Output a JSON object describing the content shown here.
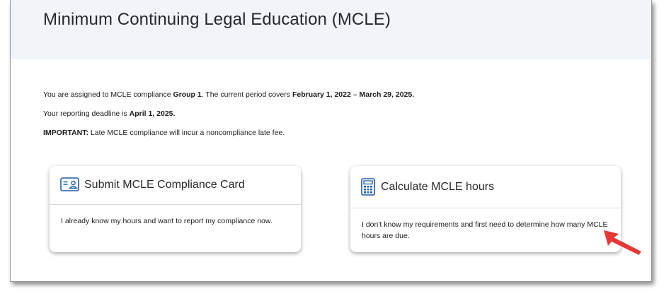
{
  "page": {
    "title": "Minimum Continuing Legal Education (MCLE)"
  },
  "info": {
    "line1_pre": "You are assigned to MCLE compliance ",
    "group": "Group 1",
    "line1_mid": ". The current period covers ",
    "period": "February 1, 2022 – March 29, 2025.",
    "line2_pre": "Your reporting deadline is ",
    "deadline": "April 1, 2025.",
    "important_label": "IMPORTANT:",
    "important_text": " Late MCLE compliance will incur a noncompliance late fee."
  },
  "cards": [
    {
      "icon": "id-card-icon",
      "title": "Submit MCLE Compliance Card",
      "description": "I already know my hours and want to report my compliance now."
    },
    {
      "icon": "calculator-icon",
      "title": "Calculate MCLE hours",
      "description": "I don't know my requirements and first need to determine how many MCLE hours are due."
    }
  ],
  "colors": {
    "header_band": "#f1f4f9",
    "icon_blue": "#1f5fa8",
    "annotation_arrow": "#e53935"
  }
}
